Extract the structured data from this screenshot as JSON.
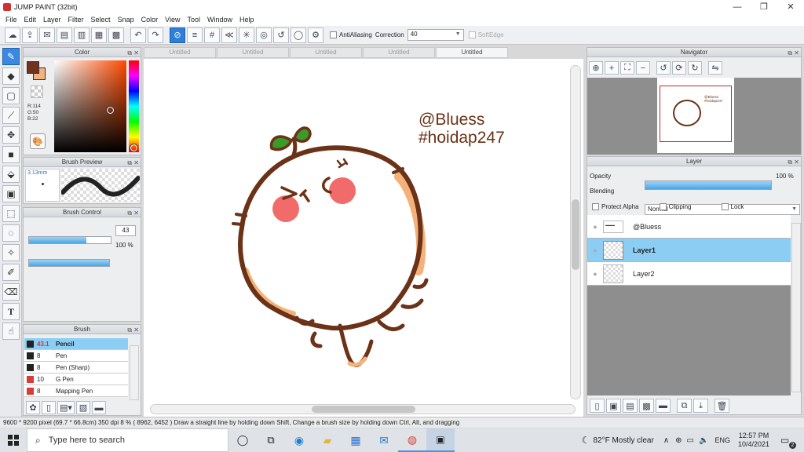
{
  "app": {
    "title": "JUMP PAINT (32bit)"
  },
  "window_controls": {
    "minimize": "—",
    "restore": "❐",
    "close": "✕"
  },
  "menu": [
    "File",
    "Edit",
    "Layer",
    "Filter",
    "Select",
    "Snap",
    "Color",
    "View",
    "Tool",
    "Window",
    "Help"
  ],
  "toolbar": {
    "antialiasing_label": "AntiAliasing",
    "correction_label": "Correction",
    "correction_value": "40",
    "softedge_label": "SoftEdge"
  },
  "color_panel": {
    "title": "Color",
    "rgb": {
      "r": "R:114",
      "g": "G:50",
      "b": "B:22"
    },
    "main_color": "#72321e",
    "sub_color": "#f2b37e"
  },
  "brush_preview": {
    "title": "Brush Preview",
    "size": "3.13mm"
  },
  "brush_control": {
    "title": "Brush Control",
    "size_value": "43",
    "opacity_value": "100 %",
    "size_fraction": 0.7,
    "opacity_fraction": 1.0
  },
  "brush_panel": {
    "title": "Brush",
    "items": [
      {
        "size": "43.1",
        "name": "Pencil",
        "color": "#222222",
        "selected": true
      },
      {
        "size": "8",
        "name": "Pen",
        "color": "#222222",
        "selected": false
      },
      {
        "size": "8",
        "name": "Pen (Sharp)",
        "color": "#222222",
        "selected": false
      },
      {
        "size": "10",
        "name": "G Pen",
        "color": "#d93a3a",
        "selected": false
      },
      {
        "size": "8",
        "name": "Mapping Pen",
        "color": "#d93a3a",
        "selected": false
      }
    ]
  },
  "tabs": [
    "Untitled",
    "Untitled",
    "Untitled",
    "Untitled",
    "Untitled"
  ],
  "canvas": {
    "watermark_line1": "@Bluess",
    "watermark_line2": "#hoidap247"
  },
  "navigator": {
    "title": "Navigator",
    "thumb_text1": "@Bluess",
    "thumb_text2": "#hoidap247"
  },
  "layer_panel": {
    "title": "Layer",
    "opacity_label": "Opacity",
    "opacity_value": "100 %",
    "blending_label": "Blending",
    "blending_value": "Normal",
    "protect_alpha": "Protect Alpha",
    "clipping": "Clipping",
    "lock": "Lock",
    "layers": [
      {
        "name": "@Bluess",
        "selected": false
      },
      {
        "name": "Layer1",
        "selected": true
      },
      {
        "name": "Layer2",
        "selected": false
      }
    ]
  },
  "status": {
    "text": "9600 * 9200 pixel   (69.7 * 66.8cm)   350 dpi   8 %   ( 8962, 6452 )   Draw a straight line by holding down Shift, Change a brush size by holding down Ctrl, Alt, and dragging"
  },
  "taskbar": {
    "search_placeholder": "Type here to search",
    "weather": "82°F  Mostly clear",
    "language": "ENG",
    "time": "12:57 PM",
    "date": "10/4/2021",
    "notifications": "2"
  }
}
